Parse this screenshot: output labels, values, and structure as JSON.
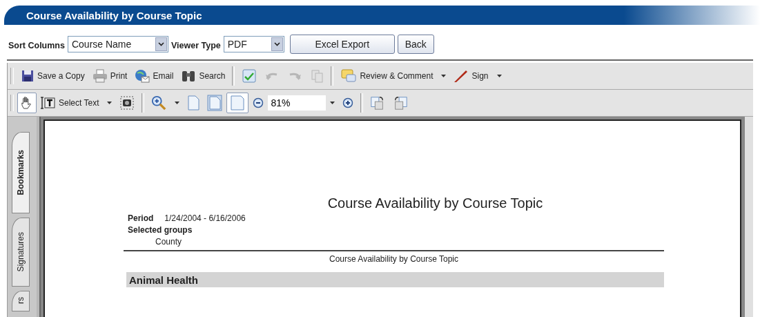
{
  "header": {
    "title": "Course Availability by Course Topic"
  },
  "controls": {
    "sort_label": "Sort Columns",
    "sort_value": "Course Name",
    "viewer_label": "Viewer Type",
    "viewer_value": "PDF",
    "buttons": [
      "Excel Export",
      "Back"
    ]
  },
  "toolbar_1": {
    "save": "Save a Copy",
    "print": "Print",
    "email": "Email",
    "search": "Search",
    "undo_disabled": true,
    "redo_disabled": true,
    "copy_disabled": true,
    "review": "Review & Comment",
    "sign": "Sign"
  },
  "toolbar_2": {
    "hand_selected": true,
    "select_text": "Select Text",
    "fit_width_selected": true,
    "zoom": "81%"
  },
  "side_tabs": [
    {
      "label": "Bookmarks",
      "selected": true
    },
    {
      "label": "Signatures",
      "selected": false
    },
    {
      "label": "rs",
      "selected": false
    }
  ],
  "document": {
    "title": "Course Availability by Course Topic",
    "period_label": "Period",
    "period_value": "1/24/2004 - 6/16/2006",
    "groups_label": "Selected groups",
    "group": "County",
    "subtitle": "Course Availability by Course Topic",
    "section": "Animal Health"
  }
}
